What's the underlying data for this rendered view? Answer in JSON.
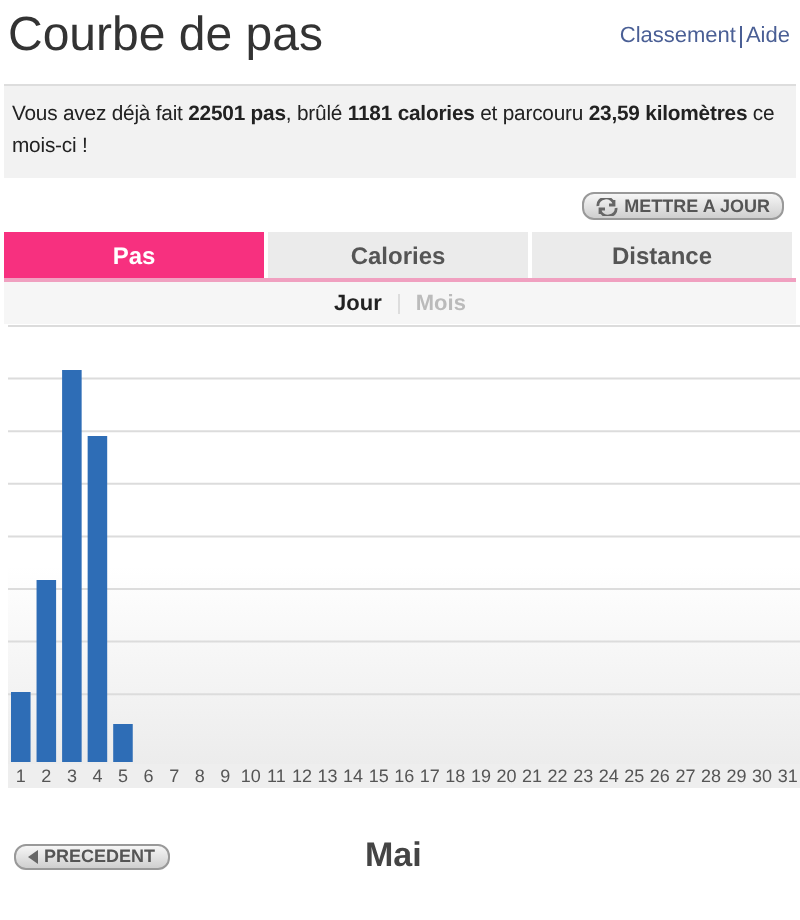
{
  "title": "Courbe de pas",
  "links": [
    "Classement",
    "Aide"
  ],
  "summary": "Vous avez déjà fait **22501 pas**, brûlé **1181 calories** et parcouru **23,59 kilomètres** ce mois-ci !",
  "update_button": "METTRE A JOUR",
  "tabs": [
    {
      "label": "Pas",
      "selected": true
    },
    {
      "label": "Calories",
      "selected": false
    },
    {
      "label": "Distance",
      "selected": false
    }
  ],
  "periods": [
    {
      "label": "Jour",
      "selected": true
    },
    {
      "label": "Mois",
      "selected": false
    }
  ],
  "chart": {
    "kind": "picture",
    "day_labels": [
      "1",
      "2",
      "3",
      "4",
      "5",
      "6",
      "7",
      "8",
      "9",
      "10",
      "11",
      "12",
      "13",
      "14",
      "15",
      "16",
      "17",
      "18",
      "19",
      "20",
      "21",
      "22",
      "23",
      "24",
      "25",
      "26",
      "27",
      "28",
      "29",
      "30",
      "31"
    ]
  },
  "previous_button": "PRECEDENT",
  "month": "Mai"
}
